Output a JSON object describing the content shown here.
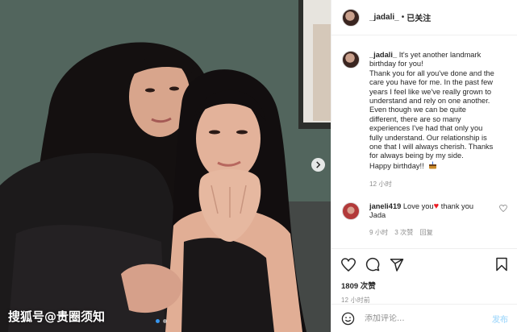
{
  "post": {
    "username": "_jadali_",
    "separator": "•",
    "following_label": "已关注",
    "caption_lines": [
      "It's yet another landmark",
      "birthday for you!",
      "Thank you for all you've done and the",
      "care you have for me. In the past few",
      "years I feel like we've really grown to",
      "understand and rely on one another.",
      "Even though we can be quite",
      "different, there are so many",
      "experiences I've had that only you",
      "fully understand. Our relationship is",
      "one that I will always cherish. Thanks",
      "for always being by my side.",
      "Happy birthday!!"
    ],
    "caption_emoji": "cake-emoji",
    "caption_time": "12 小时"
  },
  "reply": {
    "username": "janeli419",
    "text_before": "Love you",
    "text_after": "thank you",
    "text_line2": "Jada",
    "time": "9 小时",
    "likes": "3 次赞",
    "reply_label": "回复"
  },
  "actions": {
    "likes": "1809 次赞",
    "time": "12 小时前",
    "icons": [
      "heart-icon",
      "comment-icon",
      "share-icon",
      "bookmark-icon"
    ]
  },
  "comment_box": {
    "placeholder": "添加评论...",
    "post_label": "发布"
  },
  "photo": {
    "watermark": "搜狐号@贵圈须知",
    "slide_count": 2,
    "active_slide": 1
  },
  "colors": {
    "accent": "#3897f0",
    "post_button_disabled": "#b2dffc",
    "heart_red": "#ed1c24",
    "muted_text": "#8e8e8e",
    "wall": "#4f6159"
  }
}
